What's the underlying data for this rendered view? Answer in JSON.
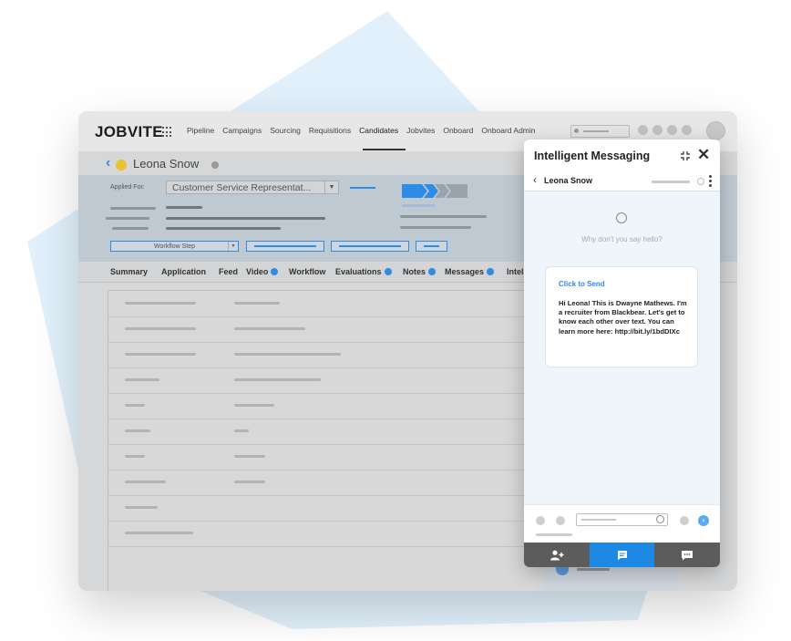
{
  "app": {
    "logo": "JOBVITE",
    "nav": [
      "Pipeline",
      "Campaigns",
      "Sourcing",
      "Requisitions",
      "Candidates",
      "Jobvites",
      "Onboard",
      "Onboard Admin"
    ],
    "active_nav": "Candidates"
  },
  "candidate": {
    "name": "Leona Snow",
    "applied_for_label": "Applied For:",
    "job": "Customer Service Representat...",
    "workflow_step_label": "Workflow Step"
  },
  "tabs": [
    {
      "label": "Summary"
    },
    {
      "label": "Application"
    },
    {
      "label": "Feed"
    },
    {
      "label": "Video"
    },
    {
      "label": "Workflow"
    },
    {
      "label": "Evaluations"
    },
    {
      "label": "Notes"
    },
    {
      "label": "Messages"
    },
    {
      "label": "Intel"
    }
  ],
  "chat": {
    "title": "Intelligent Messaging",
    "contact": "Leona Snow",
    "empty_prompt": "Why don't you say hello?",
    "click_to_send": "Click to Send",
    "message": "Hi Leona! This is Dwayne Mathews. I'm a recruiter from Blackbear. Let's get to know each other over text. You can learn more here: http://bit.ly/1bdDIXc",
    "footer_tabs": [
      "add-contact-icon",
      "message-icon",
      "chat-bubble-icon"
    ]
  },
  "colors": {
    "accent": "#2e8ce6",
    "candidate_status": "#e8c230",
    "footer_active": "#1e88e5",
    "footer_bg": "#5c5c5c"
  }
}
